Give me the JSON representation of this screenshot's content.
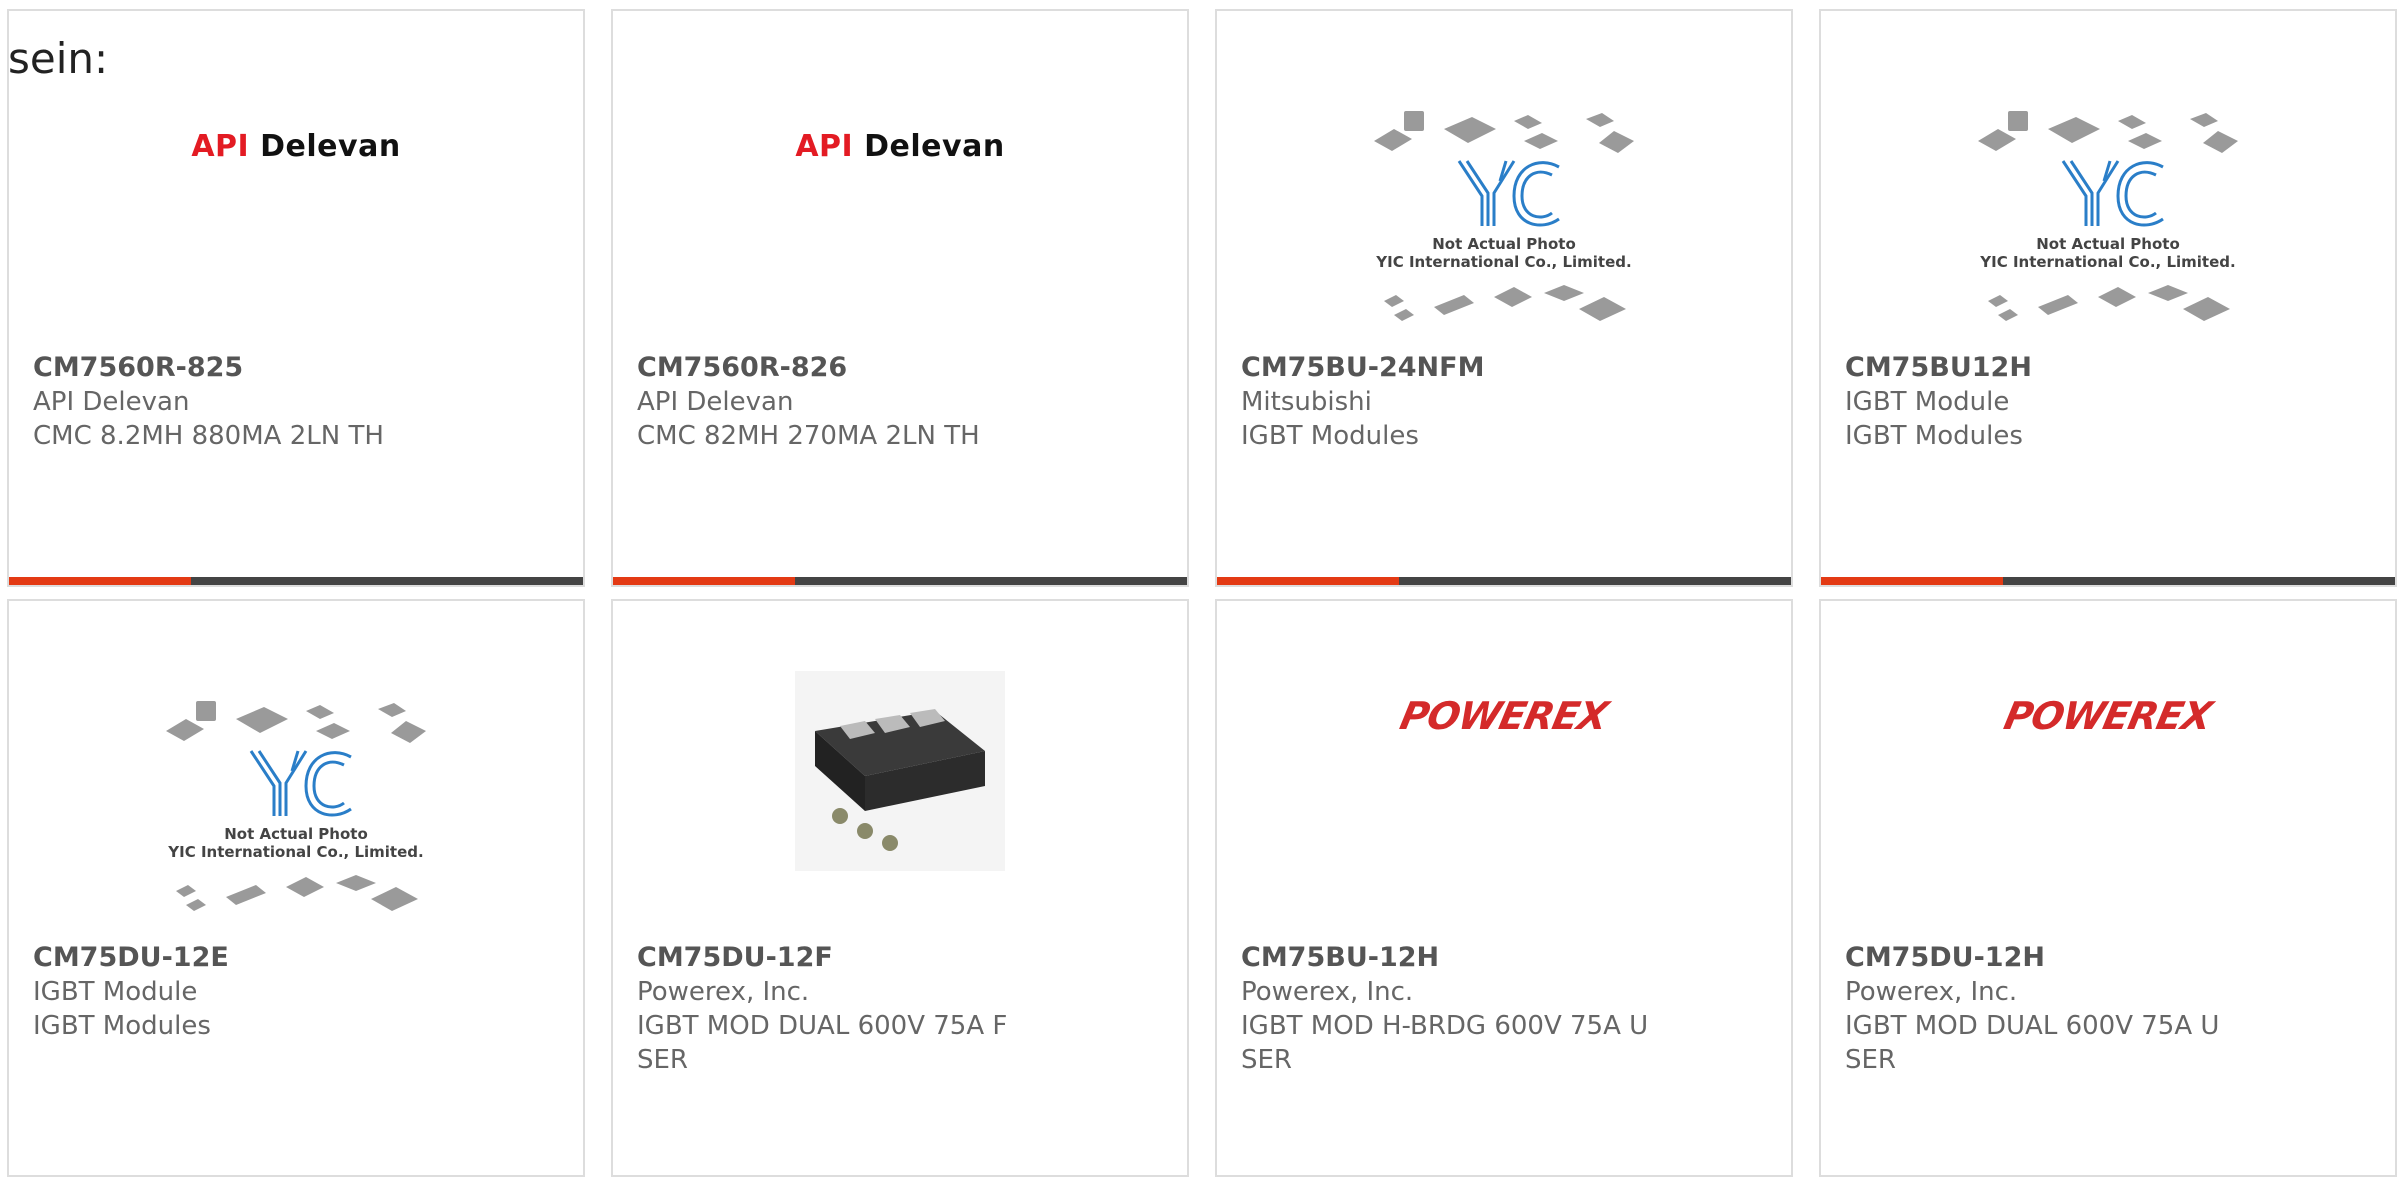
{
  "intro_text": "sein:",
  "colors": {
    "accent": "#e33a14",
    "bar": "#444444",
    "border": "#dddddd",
    "api_red": "#e31b23",
    "powerex_red": "#d42a2a",
    "yic_blue": "#2a7ec8"
  },
  "yic_placeholder": {
    "line1": "Not Actual Photo",
    "line2": "YIC International Co., Limited."
  },
  "logos": {
    "api_red": "API",
    "api_black": "Delevan",
    "powerex": "POWEREX"
  },
  "products": [
    {
      "part": "CM7560R-825",
      "mfr": "API Delevan",
      "desc": "CMC 8.2MH 880MA 2LN TH",
      "image": "api-delevan-logo"
    },
    {
      "part": "CM7560R-826",
      "mfr": "API Delevan",
      "desc": "CMC 82MH 270MA 2LN TH",
      "image": "api-delevan-logo"
    },
    {
      "part": "CM75BU-24NFM",
      "mfr": "Mitsubishi",
      "desc": "IGBT Modules",
      "image": "yic-placeholder"
    },
    {
      "part": "CM75BU12H",
      "mfr": "IGBT Module",
      "desc": "IGBT Modules",
      "image": "yic-placeholder"
    },
    {
      "part": "CM75DU-12E",
      "mfr": "IGBT Module",
      "desc": "IGBT Modules",
      "image": "yic-placeholder"
    },
    {
      "part": "CM75DU-12F",
      "mfr": "Powerex, Inc.",
      "desc": "IGBT MOD DUAL 600V 75A F SER",
      "image": "igbt-module-photo"
    },
    {
      "part": "CM75BU-12H",
      "mfr": "Powerex, Inc.",
      "desc": "IGBT MOD H-BRDG 600V 75A U SER",
      "image": "powerex-logo"
    },
    {
      "part": "CM75DU-12H",
      "mfr": "Powerex, Inc.",
      "desc": "IGBT MOD DUAL 600V 75A U SER",
      "image": "powerex-logo"
    }
  ]
}
